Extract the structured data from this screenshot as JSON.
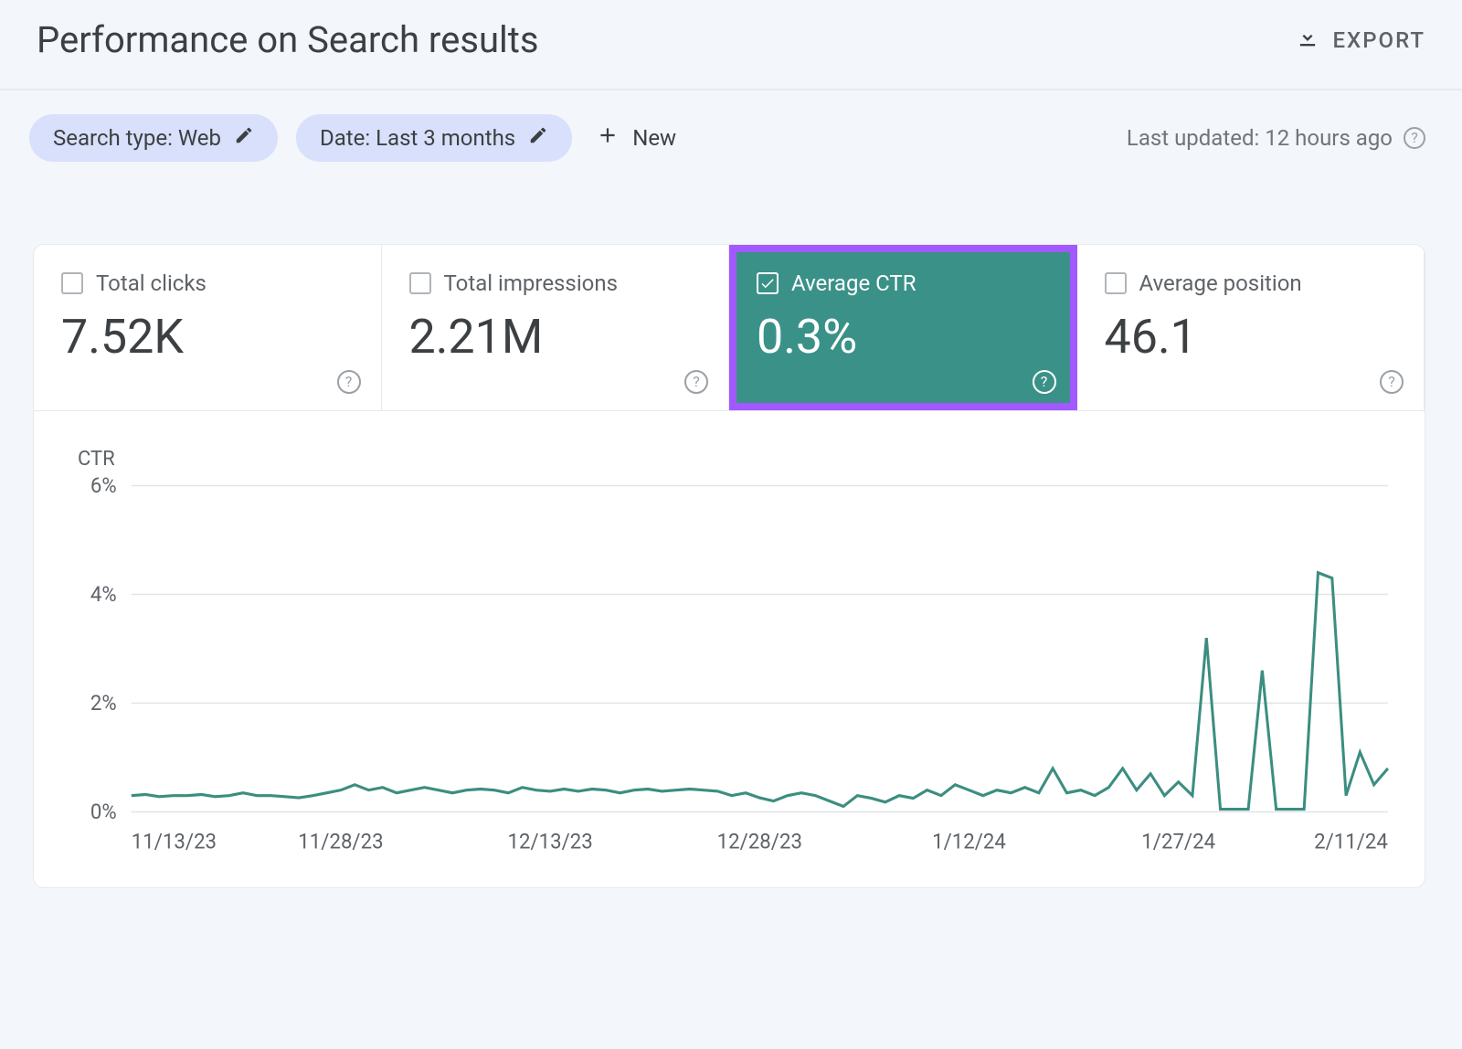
{
  "header": {
    "title": "Performance on Search results",
    "export_label": "EXPORT"
  },
  "filters": {
    "search_type": "Search type: Web",
    "date_range": "Date: Last 3 months",
    "new_label": "New",
    "last_updated": "Last updated: 12 hours ago"
  },
  "metrics": [
    {
      "id": "clicks",
      "label": "Total clicks",
      "value": "7.52K",
      "selected": false
    },
    {
      "id": "impressions",
      "label": "Total impressions",
      "value": "2.21M",
      "selected": false
    },
    {
      "id": "ctr",
      "label": "Average CTR",
      "value": "0.3%",
      "selected": true,
      "highlighted": true
    },
    {
      "id": "position",
      "label": "Average position",
      "value": "46.1",
      "selected": false
    }
  ],
  "chart_axis_title": "CTR",
  "chart_data": {
    "type": "line",
    "title": "CTR",
    "xlabel": "",
    "ylabel": "CTR",
    "ylim": [
      0,
      6
    ],
    "ytick_suffix": "%",
    "yticks": [
      0,
      2,
      4,
      6
    ],
    "xticks": [
      "11/13/23",
      "11/28/23",
      "12/13/23",
      "12/28/23",
      "1/12/24",
      "1/27/24",
      "2/11/24"
    ],
    "series": [
      {
        "name": "Average CTR",
        "color": "#3b8e80",
        "values": [
          0.3,
          0.32,
          0.28,
          0.3,
          0.3,
          0.32,
          0.28,
          0.3,
          0.35,
          0.3,
          0.3,
          0.28,
          0.26,
          0.3,
          0.35,
          0.4,
          0.5,
          0.4,
          0.45,
          0.35,
          0.4,
          0.45,
          0.4,
          0.35,
          0.4,
          0.42,
          0.4,
          0.35,
          0.45,
          0.4,
          0.38,
          0.42,
          0.38,
          0.42,
          0.4,
          0.35,
          0.4,
          0.42,
          0.38,
          0.4,
          0.42,
          0.4,
          0.38,
          0.3,
          0.35,
          0.26,
          0.2,
          0.3,
          0.35,
          0.3,
          0.2,
          0.1,
          0.3,
          0.25,
          0.18,
          0.3,
          0.25,
          0.4,
          0.3,
          0.5,
          0.4,
          0.3,
          0.4,
          0.35,
          0.45,
          0.35,
          0.8,
          0.35,
          0.4,
          0.3,
          0.45,
          0.8,
          0.4,
          0.7,
          0.3,
          0.55,
          0.3,
          3.2,
          0.05,
          0.05,
          0.05,
          2.6,
          0.05,
          0.05,
          0.05,
          4.4,
          4.3,
          0.3,
          1.1,
          0.5,
          0.8
        ]
      }
    ]
  }
}
